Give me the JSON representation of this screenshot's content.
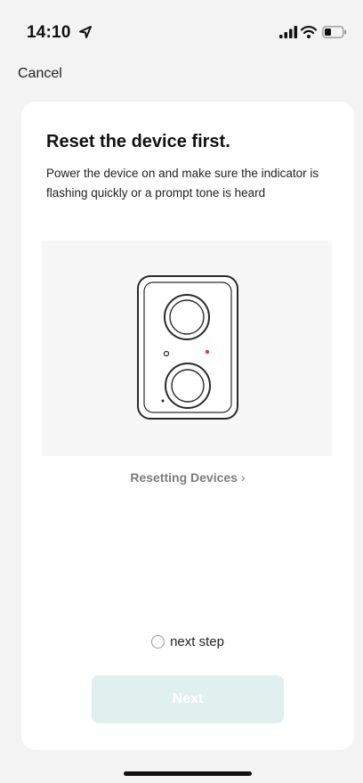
{
  "status_bar": {
    "time": "14:10",
    "icons": [
      "location-arrow-icon",
      "cellular-signal-icon",
      "wifi-icon",
      "battery-icon"
    ]
  },
  "nav": {
    "cancel_label": "Cancel"
  },
  "card": {
    "title": "Reset the device first.",
    "description": "Power the device on and make sure the indicator is flashing quickly or a prompt tone is heard",
    "illustration_icon": "doorbell-camera-icon",
    "help_link_label": "Resetting Devices",
    "help_link_icon": "chevron-right-icon",
    "confirm_label": "next step",
    "confirm_checked": false,
    "next_button_label": "Next"
  },
  "colors": {
    "background": "#f3f3f4",
    "card": "#ffffff",
    "next_button_disabled": "#dff0ef",
    "indicator_led": "#e23b3b"
  }
}
